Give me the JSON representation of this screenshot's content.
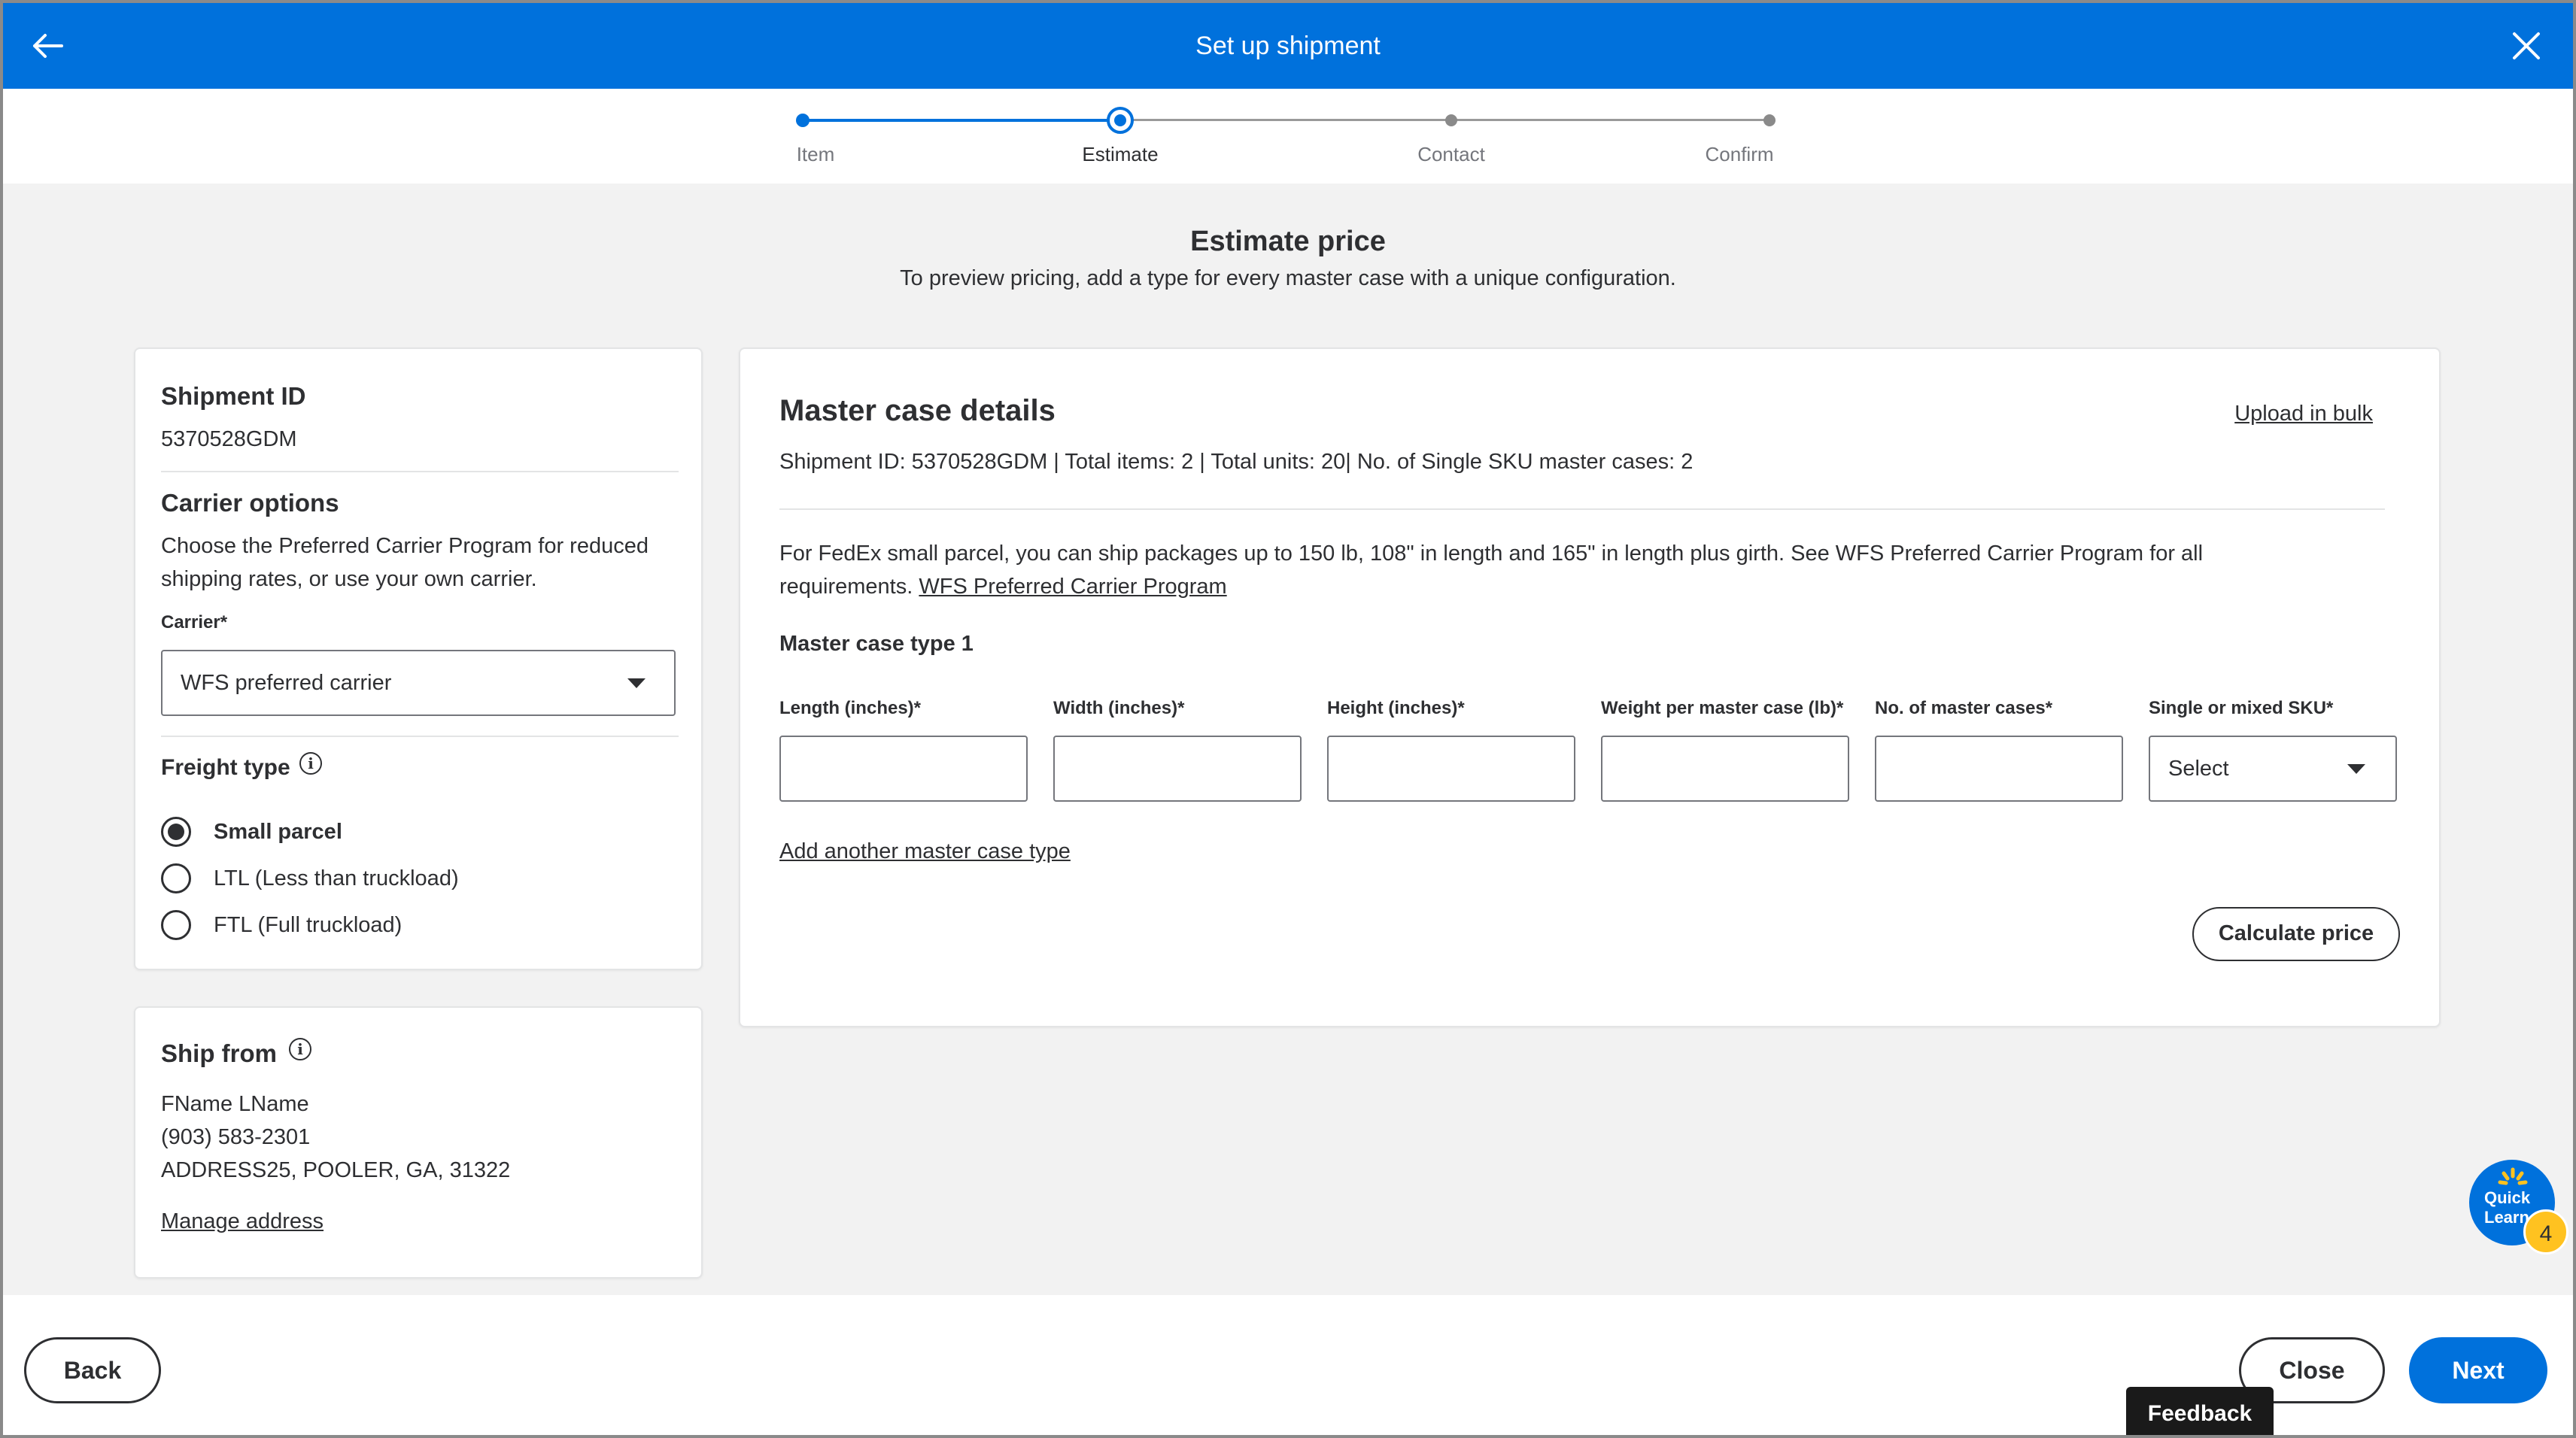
{
  "header": {
    "title": "Set up shipment",
    "back_icon": "arrow-left-icon",
    "close_icon": "close-icon",
    "color": "#0071dc"
  },
  "stepper": {
    "steps": [
      {
        "label": "Item",
        "state": "done"
      },
      {
        "label": "Estimate",
        "state": "current"
      },
      {
        "label": "Contact",
        "state": "upcoming"
      },
      {
        "label": "Confirm",
        "state": "upcoming"
      }
    ]
  },
  "intro": {
    "title": "Estimate price",
    "subtitle": "To preview pricing, add a type for every master case with a unique configuration."
  },
  "left_panel": {
    "shipment_id_heading": "Shipment ID",
    "shipment_id_value": "5370528GDM",
    "carrier_heading": "Carrier options",
    "carrier_description": "Choose the Preferred Carrier Program for reduced shipping rates, or use your own carrier.",
    "carrier_label": "Carrier*",
    "carrier_value": "WFS preferred carrier",
    "freight_heading": "Freight type",
    "freight_options": [
      {
        "label": "Small parcel",
        "checked": true
      },
      {
        "label": "LTL (Less than truckload)",
        "checked": false
      },
      {
        "label": "FTL (Full truckload)",
        "checked": false
      }
    ]
  },
  "ship_from": {
    "heading": "Ship from",
    "name": "FName LName",
    "phone": "(903) 583-2301",
    "address": "ADDRESS25, POOLER, GA, 31322",
    "manage_link": "Manage address"
  },
  "master_case": {
    "heading": "Master case details",
    "upload_link": "Upload in bulk",
    "summary": "Shipment ID: 5370528GDM | Total items: 2 | Total units: 20| No. of Single SKU master cases: 2",
    "notice": "For FedEx small parcel, you can ship packages up to 150 lb, 108\" in length and 165\" in length plus girth. See WFS Preferred Carrier Program for all requirements.",
    "notice_link": "WFS Preferred Carrier Program",
    "type_heading": "Master case type 1",
    "fields": [
      {
        "label": "Length (inches)*",
        "value": ""
      },
      {
        "label": "Width (inches)*",
        "value": ""
      },
      {
        "label": "Height (inches)*",
        "value": ""
      },
      {
        "label": "Weight per master case (lb)*",
        "value": ""
      },
      {
        "label": "No. of master cases*",
        "value": ""
      }
    ],
    "sku_label": "Single or mixed SKU*",
    "sku_value": "Select",
    "add_link": "Add another master case type",
    "calculate_button": "Calculate price"
  },
  "footer": {
    "back_button": "Back",
    "close_button": "Close",
    "next_button": "Next"
  },
  "widgets": {
    "feedback": "Feedback",
    "quick_learn": "Quick Learn",
    "quick_learn_badge": "4"
  }
}
